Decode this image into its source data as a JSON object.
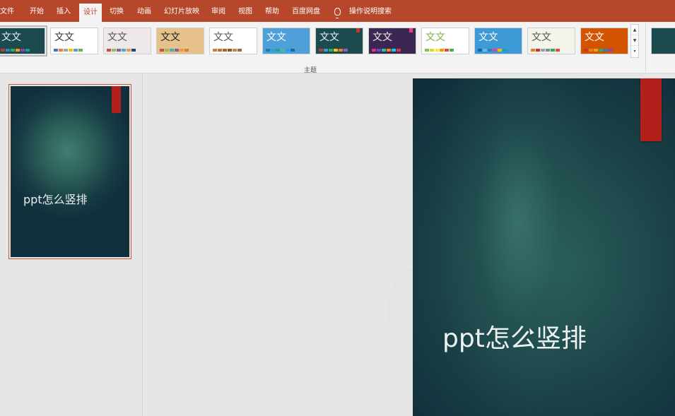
{
  "menu": {
    "tabs": [
      {
        "label": "文件"
      },
      {
        "label": "开始"
      },
      {
        "label": "插入"
      },
      {
        "label": "设计"
      },
      {
        "label": "切换"
      },
      {
        "label": "动画"
      },
      {
        "label": "幻灯片放映"
      },
      {
        "label": "审阅"
      },
      {
        "label": "视图"
      },
      {
        "label": "帮助"
      },
      {
        "label": "百度网盘"
      }
    ],
    "active_tab": "设计",
    "search_label": "操作说明搜索"
  },
  "ribbon": {
    "group_label": "主题",
    "theme_text": "文文",
    "themes": [
      {
        "name": "theme-current",
        "bg": "#1c4a4f",
        "fg": "#e8f0ef",
        "dots": [
          "#c0392b",
          "#2e86c1",
          "#27ae60",
          "#f39c12",
          "#8e44ad",
          "#16a085"
        ]
      },
      {
        "name": "theme-office",
        "bg": "#ffffff",
        "fg": "#333333",
        "dots": [
          "#4472c4",
          "#ed7d31",
          "#a5a5a5",
          "#ffc000",
          "#5b9bd5",
          "#70ad47"
        ]
      },
      {
        "name": "theme-facet",
        "bg": "#efe8e8",
        "fg": "#555555",
        "dots": [
          "#c0504d",
          "#9bbb59",
          "#8064a2",
          "#4bacc6",
          "#f79646",
          "#1f497d"
        ]
      },
      {
        "name": "theme-wood",
        "bg": "#e6c28a",
        "fg": "#222222",
        "dots": [
          "#c0504d",
          "#9bbb59",
          "#4bacc6",
          "#8064a2",
          "#f79646",
          "#c58a3a"
        ]
      },
      {
        "name": "theme-organic",
        "bg": "#ffffff",
        "fg": "#555555",
        "dots": [
          "#d17b2e",
          "#b9742b",
          "#a9672a",
          "#8a5a2e",
          "#c48a3f",
          "#9e6b3c"
        ]
      },
      {
        "name": "theme-pattern",
        "bg": "#4f9fd8",
        "fg": "#ffffff",
        "dots": [
          "#1f78b4",
          "#33a0d0",
          "#1aa39a",
          "#52b788",
          "#2a9df4",
          "#166d9c"
        ]
      },
      {
        "name": "theme-teal-dark",
        "bg": "#1c4a4f",
        "fg": "#e8f0ef",
        "dots": [
          "#c0392b",
          "#3498db",
          "#27ae60",
          "#f1c40f",
          "#e67e22",
          "#9b59b6"
        ]
      },
      {
        "name": "theme-purple",
        "bg": "#3b2752",
        "fg": "#eeeeee",
        "dots": [
          "#d63384",
          "#6f42c1",
          "#20c997",
          "#fd7e14",
          "#0dcaf0",
          "#dc3545"
        ]
      },
      {
        "name": "theme-green",
        "bg": "#ffffff",
        "fg": "#7cb342",
        "dots": [
          "#8bc34a",
          "#cddc39",
          "#ffeb3b",
          "#ff9800",
          "#f44336",
          "#4caf50"
        ]
      },
      {
        "name": "theme-blue",
        "bg": "#3d9ad6",
        "fg": "#ffffff",
        "dots": [
          "#1e5fa8",
          "#5bc0de",
          "#2c7fb8",
          "#e83e8c",
          "#f7b500",
          "#17a2b8"
        ]
      },
      {
        "name": "theme-paper",
        "bg": "#f4f4ea",
        "fg": "#555555",
        "dots": [
          "#e67e22",
          "#c0392b",
          "#95a5a6",
          "#7f8c8d",
          "#27ae60",
          "#e74c3c"
        ]
      },
      {
        "name": "theme-orange",
        "bg": "#d35400",
        "fg": "#ffffff",
        "dots": [
          "#c0392b",
          "#e67e22",
          "#f39c12",
          "#27ae60",
          "#2980b9",
          "#8e44ad"
        ]
      }
    ],
    "extra_theme": {
      "bg": "#1c4a4f",
      "fg": "#e8f0ef"
    }
  },
  "slides": [
    {
      "number": 1,
      "title": "ppt怎么竖排"
    }
  ],
  "current_slide": {
    "title": "ppt怎么竖排"
  },
  "colors": {
    "accent": "#b7472a",
    "slide_ribbon": "#b1201b"
  }
}
